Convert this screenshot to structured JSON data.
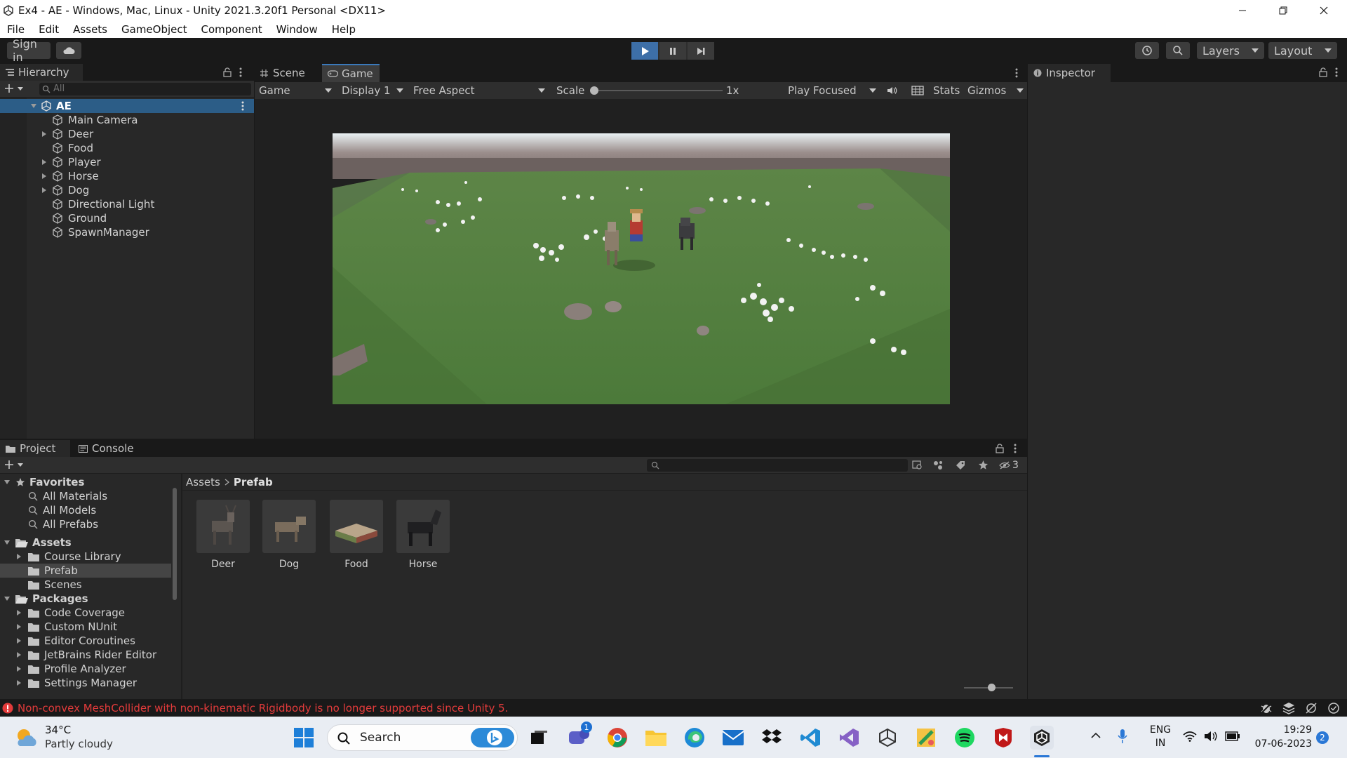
{
  "window": {
    "title": "Ex4 - AE - Windows, Mac, Linux - Unity 2021.3.20f1 Personal <DX11>"
  },
  "menu": [
    "File",
    "Edit",
    "Assets",
    "GameObject",
    "Component",
    "Window",
    "Help"
  ],
  "toolbar": {
    "sign_in": "Sign in",
    "layers": "Layers",
    "layout": "Layout"
  },
  "hierarchy": {
    "tab": "Hierarchy",
    "search_placeholder": "All",
    "root": "AE",
    "items": [
      {
        "label": "Main Camera",
        "expandable": false
      },
      {
        "label": "Deer",
        "expandable": true
      },
      {
        "label": "Food",
        "expandable": false
      },
      {
        "label": "Player",
        "expandable": true
      },
      {
        "label": "Horse",
        "expandable": true
      },
      {
        "label": "Dog",
        "expandable": true
      },
      {
        "label": "Directional Light",
        "expandable": false
      },
      {
        "label": "Ground",
        "expandable": false
      },
      {
        "label": "SpawnManager",
        "expandable": false
      }
    ]
  },
  "center_tabs": {
    "scene": "Scene",
    "game": "Game"
  },
  "game_bar": {
    "view": "Game",
    "display": "Display 1",
    "aspect": "Free Aspect",
    "scale_label": "Scale",
    "scale_value": "1x",
    "play_mode": "Play Focused",
    "stats": "Stats",
    "gizmos": "Gizmos"
  },
  "inspector": {
    "tab": "Inspector"
  },
  "project": {
    "tab_project": "Project",
    "tab_console": "Console",
    "hidden_count": "3",
    "favorites": {
      "label": "Favorites",
      "items": [
        "All Materials",
        "All Models",
        "All Prefabs"
      ]
    },
    "assets": {
      "label": "Assets",
      "items": [
        {
          "label": "Course Library",
          "expandable": true,
          "selected": false
        },
        {
          "label": "Prefab",
          "expandable": false,
          "selected": true
        },
        {
          "label": "Scenes",
          "expandable": false,
          "selected": false
        }
      ]
    },
    "packages": {
      "label": "Packages",
      "items": [
        "Code Coverage",
        "Custom NUnit",
        "Editor Coroutines",
        "JetBrains Rider Editor",
        "Profile Analyzer",
        "Settings Manager"
      ]
    },
    "breadcrumb": [
      "Assets",
      "Prefab"
    ],
    "prefabs": [
      "Deer",
      "Dog",
      "Food",
      "Horse"
    ]
  },
  "status": {
    "message": "Non-convex MeshCollider with non-kinematic Rigidbody is no longer supported since Unity 5."
  },
  "taskbar": {
    "weather_temp": "34°C",
    "weather_desc": "Partly cloudy",
    "search": "Search",
    "chat_badge": "1",
    "lang_top": "ENG",
    "lang_bottom": "IN",
    "time": "19:29",
    "date": "07-06-2023",
    "notif_count": "2"
  },
  "colors": {
    "accent": "#3a79bb",
    "error": "#e33b3b"
  }
}
